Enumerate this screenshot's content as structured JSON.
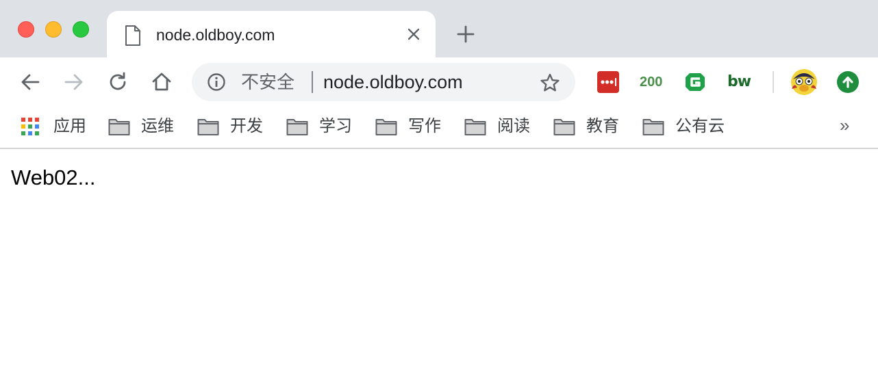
{
  "window": {
    "controls": [
      "close",
      "minimize",
      "maximize"
    ]
  },
  "tab": {
    "title": "node.oldboy.com",
    "favicon": "document-icon"
  },
  "toolbar": {
    "icons": [
      "back-arrow-icon",
      "forward-arrow-icon",
      "reload-icon",
      "home-icon"
    ],
    "omnibox": {
      "security_label": "不安全",
      "url": "node.oldboy.com",
      "info_icon": "info-icon",
      "star_icon": "star-icon"
    },
    "extensions": {
      "lastpass_icon": "lastpass-icon",
      "status_code": "200",
      "g_icon": "grammarly-g-icon",
      "bw_label": "bw",
      "avatar_icon": "profile-avatar-icon",
      "update_icon": "update-arrow-icon"
    }
  },
  "bookmarks": {
    "items": [
      {
        "label": "应用",
        "icon": "apps-grid-icon"
      },
      {
        "label": "运维",
        "icon": "folder-icon"
      },
      {
        "label": "开发",
        "icon": "folder-icon"
      },
      {
        "label": "学习",
        "icon": "folder-icon"
      },
      {
        "label": "写作",
        "icon": "folder-icon"
      },
      {
        "label": "阅读",
        "icon": "folder-icon"
      },
      {
        "label": "教育",
        "icon": "folder-icon"
      },
      {
        "label": "公有云",
        "icon": "folder-icon"
      }
    ],
    "overflow": "»"
  },
  "page": {
    "body_text": "Web02..."
  },
  "colors": {
    "tabstrip_bg": "#dee1e6",
    "omnibox_bg": "#f1f3f4",
    "close_button": "#ff5f57",
    "minimize_button": "#febc2e",
    "maximize_button": "#28c840"
  }
}
